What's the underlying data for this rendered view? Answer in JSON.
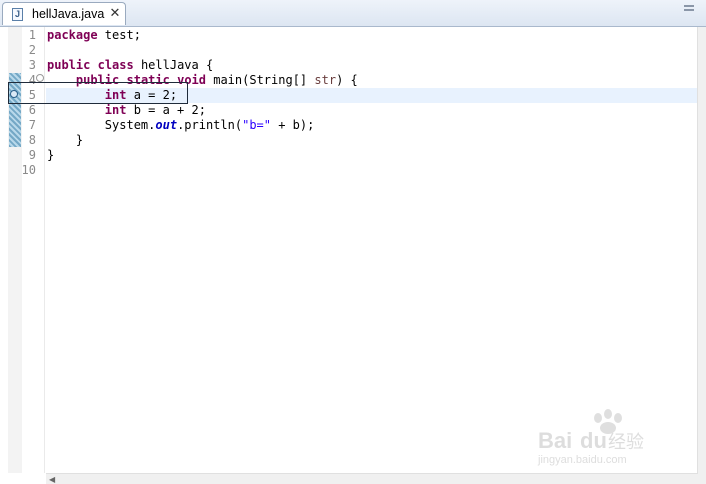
{
  "tab": {
    "icon": "java-file-icon",
    "icon_glyph": "J",
    "title": "hellJava.java",
    "close_glyph": "✕"
  },
  "editor": {
    "line_numbers": [
      "1",
      "2",
      "3",
      "4",
      "5",
      "6",
      "7",
      "8",
      "9",
      "10"
    ],
    "fold_glyph": "⊖",
    "code": {
      "l1_kw": "package",
      "l1_rest": " test;",
      "l3_kw1": "public",
      "l3_kw2": "class",
      "l3_rest": " hellJava {",
      "l4_indent": "    ",
      "l4_kw1": "public",
      "l4_kw2": "static",
      "l4_kw3": "void",
      "l4_rest": " main(String[] ",
      "l4_var": "str",
      "l4_end": ") {",
      "l5_indent": "        ",
      "l5_kw": "int",
      "l5_rest": " a = 2;",
      "l6_indent": "        ",
      "l6_kw": "int",
      "l6_rest": " b = a + 2;",
      "l7_indent": "        ",
      "l7_a": "System.",
      "l7_field": "out",
      "l7_b": ".println(",
      "l7_str": "\"b=\"",
      "l7_c": " + b);",
      "l8": "    }",
      "l9": "}"
    },
    "current_line": 5
  },
  "watermark": {
    "brand": "Bai",
    "brand2": "du",
    "suffix": "经验",
    "url": "jingyan.baidu.com"
  },
  "colors": {
    "keyword": "#7f0055",
    "string": "#2a00ff",
    "field": "#0000c0",
    "current_line": "#e8f2fe"
  }
}
